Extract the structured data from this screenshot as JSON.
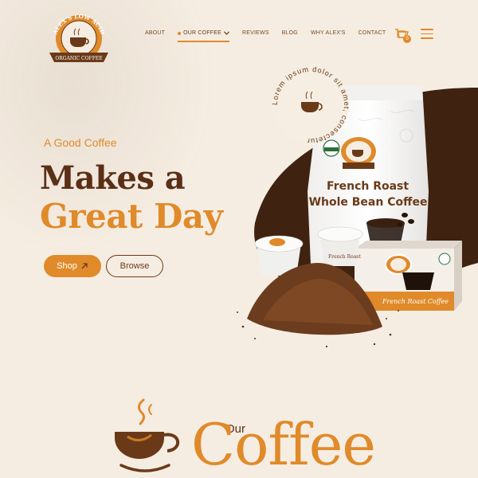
{
  "brand": {
    "logo_top_text": "ALEX'S LOW ACID",
    "logo_bottom_text": "ORGANIC COFFEE"
  },
  "nav": {
    "items": [
      {
        "label": "ABOUT"
      },
      {
        "label": "OUR COFFEE"
      },
      {
        "label": "REVIEWS"
      },
      {
        "label": "BLOG"
      },
      {
        "label": "WHY ALEX'S"
      },
      {
        "label": "CONTACT"
      }
    ],
    "cart_count": "0"
  },
  "hero": {
    "tagline": "A Good Coffee",
    "headline_line1": "Makes a",
    "headline_line2": "Great Day",
    "shop_label": "Shop",
    "browse_label": "Browse",
    "stamp_text": "Lorem ipsum dolor sit amet, consectetur",
    "bag_line1": "French Roast",
    "bag_line2": "Whole Bean Coffee",
    "box_label": "French Roast Coffee",
    "pod_label": "French Roast"
  },
  "section": {
    "small": "Our",
    "big": "Coffee"
  },
  "colors": {
    "accent": "#e08a2a",
    "dark_brown": "#5a2f16",
    "background": "#f6ede2"
  }
}
